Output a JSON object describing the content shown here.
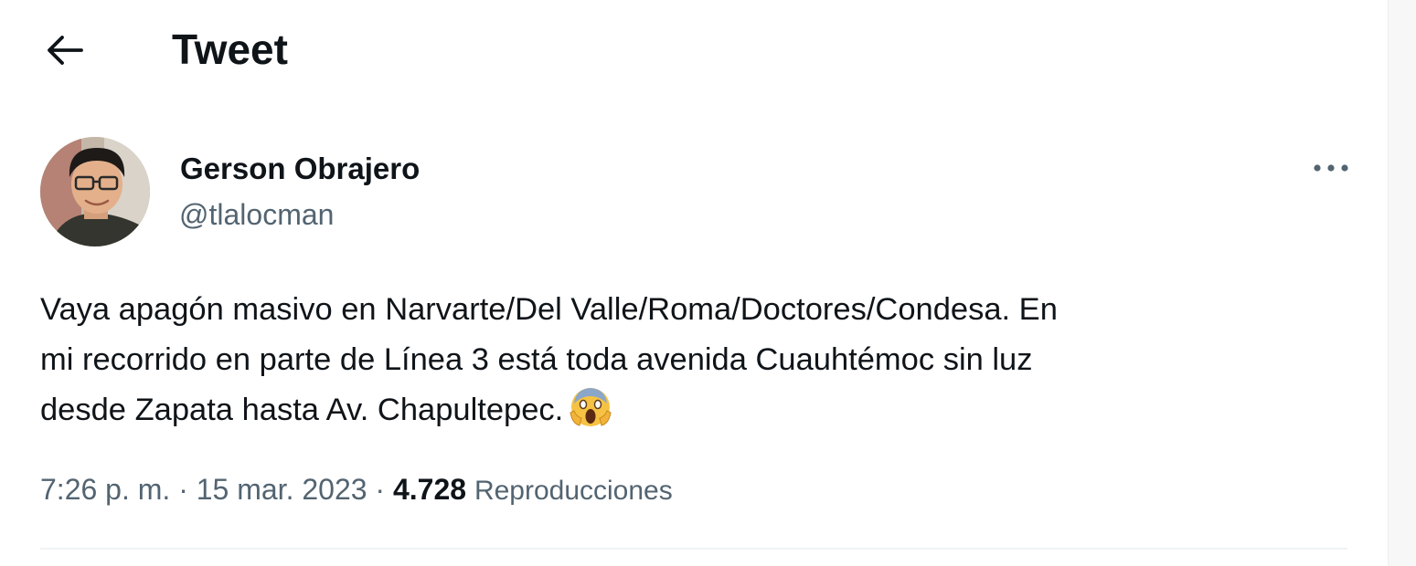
{
  "header": {
    "title": "Tweet",
    "back_icon": "arrow-left-icon"
  },
  "author": {
    "name": "Gerson Obrajero",
    "handle": "@tlalocman",
    "more_icon": "more-horizontal-icon"
  },
  "tweet": {
    "lines": [
      "Vaya apagón masivo en Narvarte/Del Valle/Roma/Doctores/Condesa. En",
      "mi recorrido en parte de Línea 3 está toda avenida Cuauhtémoc sin luz",
      "desde Zapata hasta Av. Chapultepec."
    ],
    "emoji": "screaming-face-emoji"
  },
  "meta": {
    "time": "7:26 p. m.",
    "separator": "·",
    "date": "15 mar. 2023",
    "views_count": "4.728",
    "views_label": "Reproducciones"
  },
  "colors": {
    "text_primary": "#0f1419",
    "text_secondary": "#536471",
    "divider": "#eff3f4"
  }
}
